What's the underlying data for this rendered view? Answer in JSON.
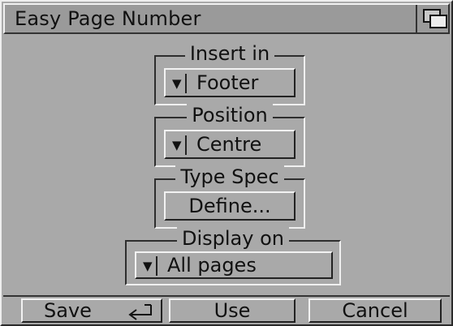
{
  "window": {
    "title": "Easy Page Number"
  },
  "groups": {
    "insert_in": {
      "label": "Insert in",
      "value": "Footer"
    },
    "position": {
      "label": "Position",
      "value": "Centre"
    },
    "type_spec": {
      "label": "Type Spec",
      "button_label": "Define..."
    },
    "display_on": {
      "label": "Display on",
      "value": "All pages"
    }
  },
  "actions": {
    "save_label": "Save",
    "use_label": "Use",
    "cancel_label": "Cancel"
  },
  "icons": {
    "depth": "depth-gadget-icon",
    "cycle": "cycle-arrow-icon",
    "return": "return-key-icon"
  }
}
